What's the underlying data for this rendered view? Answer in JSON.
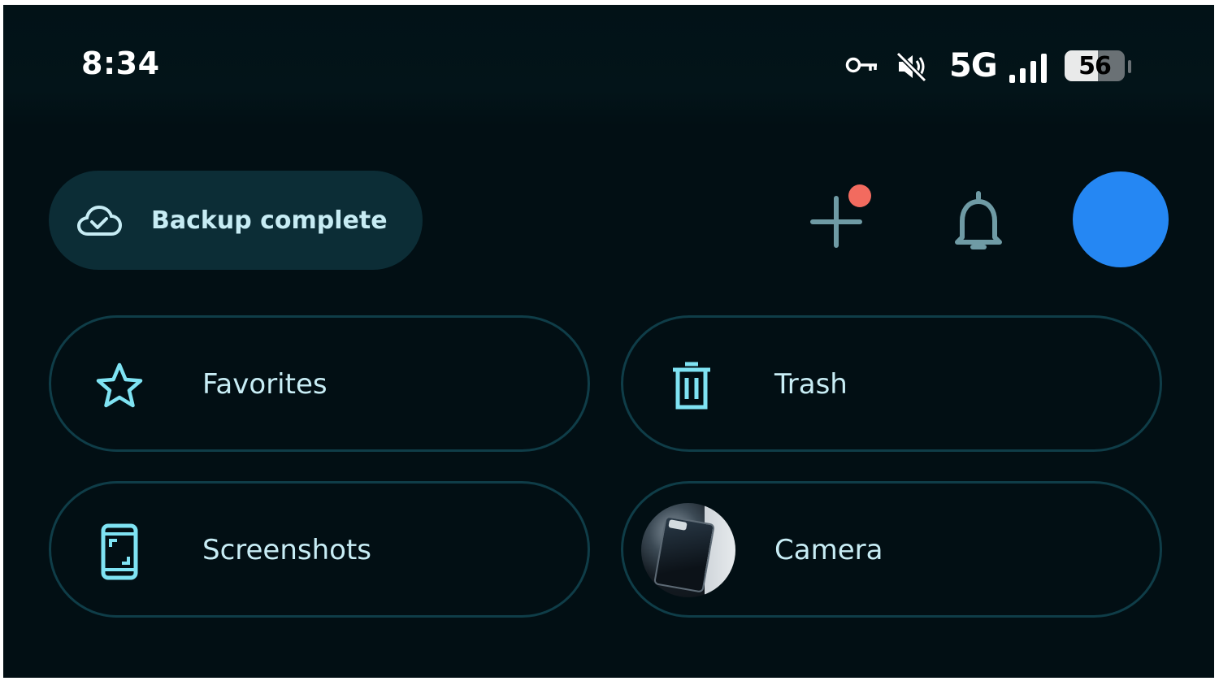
{
  "status_bar": {
    "time": "8:34",
    "network": "5G",
    "battery": "56",
    "battery_level": 0.56,
    "icons": [
      "vpn-key-icon",
      "mute-icon",
      "signal-icon",
      "battery-icon"
    ]
  },
  "header": {
    "backup_label": "Backup complete",
    "backup_icon": "cloud-check-icon",
    "add_icon": "plus-icon",
    "notification_dot_color": "#f26b5f",
    "bell_icon": "bell-icon",
    "avatar_color": "#2587f3"
  },
  "albums": [
    {
      "label": "Favorites",
      "icon": "star-icon"
    },
    {
      "label": "Trash",
      "icon": "trash-icon"
    },
    {
      "label": "Screenshots",
      "icon": "phone-screenshot-icon"
    },
    {
      "label": "Camera",
      "icon": "camera-thumbnail"
    }
  ],
  "colors": {
    "background": "#020f14",
    "chip_fill": "#0c2d36",
    "chip_border": "#0f3d48",
    "accent_icon": "#7fe3f3",
    "text": "#c8edf5",
    "muted_icon": "#6f9ba5"
  }
}
